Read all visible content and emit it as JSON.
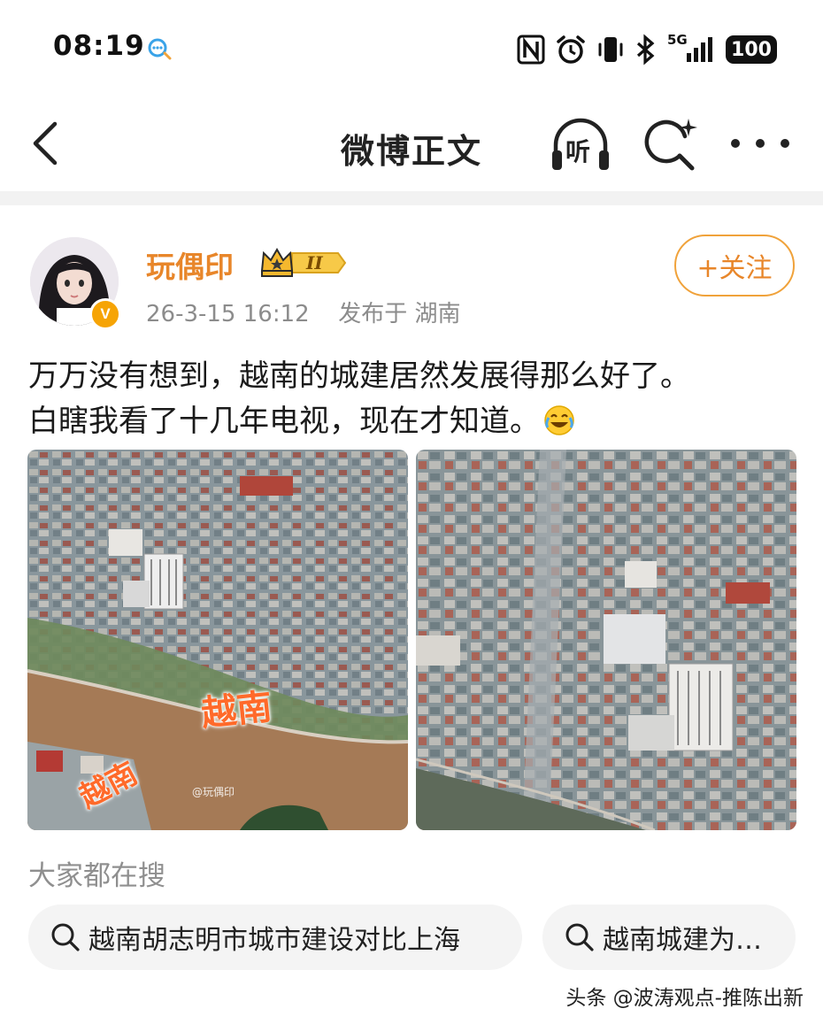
{
  "status_bar": {
    "time": "08:19",
    "network": "5G",
    "battery": "100"
  },
  "header": {
    "title": "微博正文",
    "listen_label": "听"
  },
  "author": {
    "name": "玩偶印",
    "level_badge": "II",
    "verified_badge": "V",
    "post_time": "26-3-15 16:12",
    "location": "发布于 湖南",
    "follow_label": "+关注"
  },
  "post": {
    "line1": "万万没有想到，越南的城建居然发展得那么好了。",
    "line2": "白瞎我看了十几年电视，现在才知道。",
    "emoji": "laughing-crying-icon"
  },
  "images": [
    {
      "overlay_text": "越南",
      "overlay_text_2": "越南",
      "watermark": "@玩偶印"
    },
    {
      "overlay_text": ""
    }
  ],
  "related_searches": {
    "heading": "大家都在搜",
    "items": [
      "越南胡志明市城市建设对比上海",
      "越南城建为…"
    ]
  },
  "footer": {
    "watermark": "头条 @波涛观点-推陈出新"
  },
  "colors": {
    "accent": "#e8862a",
    "follow_border": "#f0a23a",
    "verified": "#f6a405",
    "meta_text": "#8c8c8c"
  }
}
